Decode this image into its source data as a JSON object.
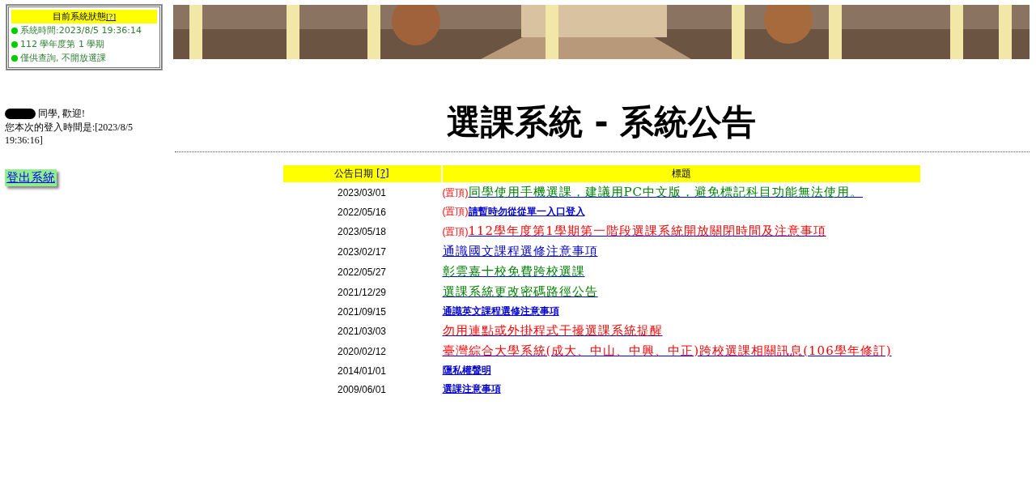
{
  "status_box": {
    "title": "目前系統狀態",
    "help_link": "[?]",
    "items": [
      {
        "text": "系統時間:2023/8/5 19:36:14",
        "color": "#00cc00"
      },
      {
        "text": "112 學年度第 1 學期",
        "color": "#00cc00"
      },
      {
        "text": "僅供查詢, 不開放選課",
        "color": "#00cc00"
      }
    ]
  },
  "user": {
    "greeting": "同學, 歡迎!",
    "login_time": "您本次的登入時間是:[2023/8/5 19:36:16]",
    "logout": "登出系統"
  },
  "heading": "選課系統 - 系統公告",
  "table": {
    "columns": [
      {
        "label": "公告日期",
        "help_link": "[?]"
      },
      {
        "label": "標題"
      }
    ],
    "rows": [
      {
        "date": "2023/03/01",
        "pin_label": "(置頂)",
        "title": "同學使用手機選課，建議用PC中文版，避免標記科目功能無法使用。",
        "color": "#008000",
        "kind": "large"
      },
      {
        "date": "2022/05/16",
        "pin_label": "(置頂)",
        "title": "請暫時勿從從單一入口登入",
        "color": "#0000cc",
        "kind": "small"
      },
      {
        "date": "2023/05/18",
        "pin_label": "(置頂)",
        "title": "112學年度第1學期第一階段選課系統開放關閉時間及注意事項",
        "color": "#ff0000",
        "kind": "large"
      },
      {
        "date": "2023/02/17",
        "title": "通識國文課程選修注意事項",
        "color": "#0000cc",
        "kind": "large"
      },
      {
        "date": "2022/05/27",
        "title": "彰雲嘉十校免費跨校選課",
        "color": "#008000",
        "kind": "large"
      },
      {
        "date": "2021/12/29",
        "title": "選課系統更改密碼路徑公告",
        "color": "#008000",
        "kind": "large"
      },
      {
        "date": "2021/09/15",
        "title": "通識英文課程選修注意事項",
        "color": "#0000cc",
        "kind": "small"
      },
      {
        "date": "2021/03/03",
        "title": "勿用連點或外掛程式干擾選課系統提醒",
        "color": "#ff0000",
        "kind": "large"
      },
      {
        "date": "2020/02/12",
        "title": "臺灣綜合大學系統(成大、中山、中興、中正)跨校選課相關訊息(106學年修訂)",
        "color": "#ff0000",
        "kind": "large"
      },
      {
        "date": "2014/01/01",
        "title": "隱私權聲明",
        "color": "#0000cc",
        "kind": "small"
      },
      {
        "date": "2009/06/01",
        "title": "選課注意事項",
        "color": "#0000cc",
        "kind": "small"
      }
    ]
  }
}
